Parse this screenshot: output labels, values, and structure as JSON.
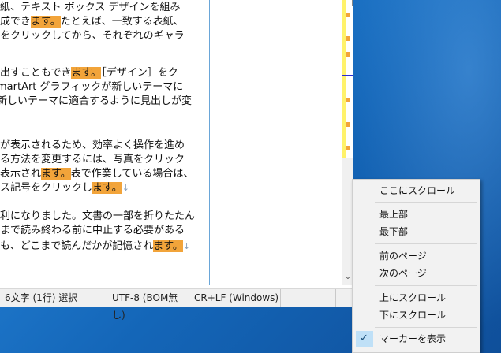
{
  "editor": {
    "lines": [
      {
        "parts": [
          {
            "t": "紙、テキスト ボックス デザインを組み"
          }
        ]
      },
      {
        "parts": [
          {
            "t": "成でき"
          },
          {
            "t": "ます。",
            "hl": true
          },
          {
            "t": "たとえば、一致する表紙、"
          }
        ]
      },
      {
        "parts": [
          {
            "t": "をクリックしてから、それぞれのギャラ"
          }
        ]
      },
      {
        "parts": [
          {
            "t": "出すこともでき"
          },
          {
            "t": "ます。",
            "hl": true
          },
          {
            "t": "［デザイン］をク"
          }
        ]
      },
      {
        "parts": [
          {
            "t": "martArt グラフィックが新しいテーマに"
          }
        ]
      },
      {
        "parts": [
          {
            "t": "新しいテーマに適合するように見出しが変"
          }
        ]
      },
      {
        "parts": [
          {
            "t": "が表示されるため、効率よく操作を進め"
          }
        ]
      },
      {
        "parts": [
          {
            "t": "る方法を変更するには、写真をクリック"
          }
        ]
      },
      {
        "parts": [
          {
            "t": "表示され"
          },
          {
            "t": "ます。",
            "hl": true
          },
          {
            "t": "表で作業している場合は、"
          }
        ]
      },
      {
        "parts": [
          {
            "t": "ス記号をクリックし"
          },
          {
            "t": "ます。",
            "hl": true
          },
          {
            "t": "↓",
            "ret": true
          }
        ]
      },
      {
        "parts": [
          {
            "t": "利になりました。文書の一部を折りたたん"
          }
        ]
      },
      {
        "parts": [
          {
            "t": "まで読み終わる前に中止する必要がある"
          }
        ]
      },
      {
        "parts": [
          {
            "t": "も、どこまで読んだかが記憶され"
          },
          {
            "t": "ます。",
            "hl": true
          },
          {
            "t": "↓",
            "ret": true
          }
        ]
      }
    ],
    "scroll_down_glyph": "⌄"
  },
  "status": {
    "selection": "6文字 (1行) 選択",
    "encoding": "UTF-8 (BOM無し)",
    "line_ending": "CR+LF (Windows)"
  },
  "menu": {
    "scroll_here": "ここにスクロール",
    "top": "最上部",
    "bottom": "最下部",
    "prev_page": "前のページ",
    "next_page": "次のページ",
    "scroll_up": "上にスクロール",
    "scroll_down": "下にスクロール",
    "show_markers": "マーカーを表示",
    "check_glyph": "✓"
  },
  "colors": {
    "highlight": "#f2a43a",
    "marker_strip": "#fff26a",
    "menu_check_bg": "#bfe0f7"
  }
}
